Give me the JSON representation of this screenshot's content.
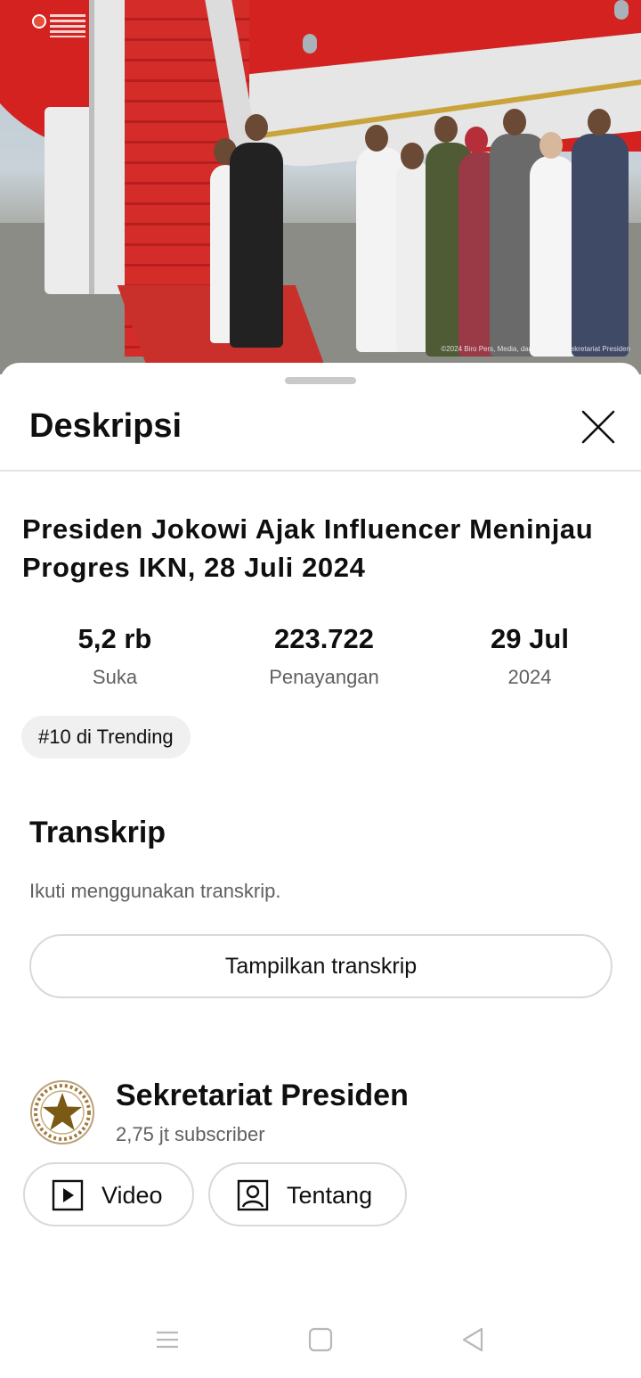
{
  "video": {
    "thumbnail": "Presiden Jokowi disambut di bawah tangga pesawat",
    "credit": "©2024 Biro Pers, Media, dan Informasi Sekretariat Presiden"
  },
  "sheet": {
    "title": "Deskripsi",
    "close_icon": "close-icon"
  },
  "description": {
    "title": "Presiden Jokowi Ajak Influencer Meninjau Progres IKN, 28 Juli 2024",
    "stats": [
      {
        "value": "5,2 rb",
        "label": "Suka"
      },
      {
        "value": "223.722",
        "label": "Penayangan"
      },
      {
        "value": "29 Jul",
        "label": "2024"
      }
    ],
    "trending_chip": "#10 di Trending"
  },
  "transcript": {
    "title": "Transkrip",
    "subtitle": "Ikuti menggunakan transkrip.",
    "button": "Tampilkan transkrip"
  },
  "channel": {
    "name": "Sekretariat Presiden",
    "subscribers": "2,75 jt subscriber",
    "buttons": [
      {
        "label": "Video",
        "icon": "play-icon"
      },
      {
        "label": "Tentang",
        "icon": "person-icon"
      }
    ]
  },
  "system_nav": {
    "icons": [
      "menu-icon",
      "home-icon",
      "back-icon"
    ]
  },
  "colors": {
    "accent_red": "#d3221f",
    "text_primary": "#0f0f0f",
    "text_secondary": "#606060",
    "chip_bg": "#f0f0f0"
  }
}
